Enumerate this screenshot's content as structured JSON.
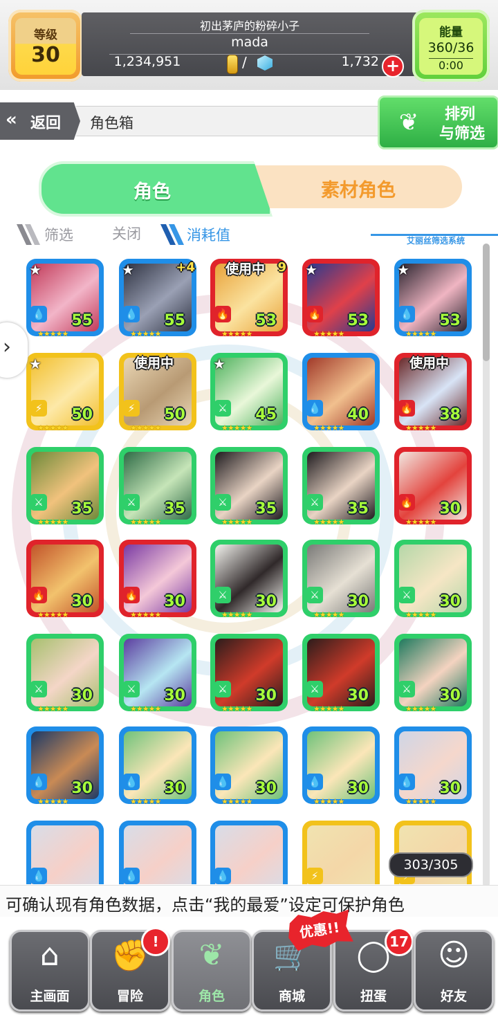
{
  "header": {
    "level_label": "等级",
    "level_value": "30",
    "player_title": "初出茅庐的粉碎小子",
    "player_name": "mada",
    "gold": "1,234,951",
    "slash": "/",
    "gems": "1,732",
    "add_label": "+",
    "energy_label": "能量",
    "energy_value": "360/36",
    "energy_timer": "0:00"
  },
  "nav": {
    "back_icon": "«",
    "back_label": "返回",
    "page_title": "角色箱",
    "sort_line1": "排列",
    "sort_line2": "与筛选",
    "sort_icon": "bunny-icon"
  },
  "tabs": {
    "characters": "角色",
    "materials": "素材角色"
  },
  "filter": {
    "filter_label": "筛选",
    "filter_state": "关闭",
    "sort_label": "消耗值",
    "system_label": "艾丽丝筛选系统"
  },
  "colors": {
    "water": "#1f8ee8",
    "fire": "#e0232b",
    "wood": "#2fcf6a",
    "thunder": "#f2c21b"
  },
  "cards": [
    {
      "level": "55",
      "element": "water",
      "star": true,
      "badge": "",
      "plus": ""
    },
    {
      "level": "55",
      "element": "water",
      "star": true,
      "badge": "",
      "plus": "+4"
    },
    {
      "level": "53",
      "element": "fire",
      "star": false,
      "badge": "使用中",
      "plus": "9"
    },
    {
      "level": "53",
      "element": "fire",
      "star": true,
      "badge": "",
      "plus": ""
    },
    {
      "level": "53",
      "element": "water",
      "star": true,
      "badge": "",
      "plus": ""
    },
    {
      "level": "50",
      "element": "thunder",
      "star": true,
      "badge": "",
      "plus": ""
    },
    {
      "level": "50",
      "element": "thunder",
      "star": false,
      "badge": "使用中",
      "plus": ""
    },
    {
      "level": "45",
      "element": "wood",
      "star": true,
      "badge": "",
      "plus": ""
    },
    {
      "level": "40",
      "element": "water",
      "star": false,
      "badge": "",
      "plus": ""
    },
    {
      "level": "38",
      "element": "fire",
      "star": false,
      "badge": "使用中",
      "plus": ""
    },
    {
      "level": "35",
      "element": "wood",
      "star": false,
      "badge": "",
      "plus": ""
    },
    {
      "level": "35",
      "element": "wood",
      "star": false,
      "badge": "",
      "plus": ""
    },
    {
      "level": "35",
      "element": "wood",
      "star": false,
      "badge": "",
      "plus": ""
    },
    {
      "level": "35",
      "element": "wood",
      "star": false,
      "badge": "",
      "plus": ""
    },
    {
      "level": "30",
      "element": "fire",
      "star": false,
      "badge": "",
      "plus": ""
    },
    {
      "level": "30",
      "element": "fire",
      "star": false,
      "badge": "",
      "plus": ""
    },
    {
      "level": "30",
      "element": "fire",
      "star": false,
      "badge": "",
      "plus": ""
    },
    {
      "level": "30",
      "element": "wood",
      "star": false,
      "badge": "",
      "plus": ""
    },
    {
      "level": "30",
      "element": "wood",
      "star": false,
      "badge": "",
      "plus": ""
    },
    {
      "level": "30",
      "element": "wood",
      "star": false,
      "badge": "",
      "plus": ""
    },
    {
      "level": "30",
      "element": "wood",
      "star": false,
      "badge": "",
      "plus": ""
    },
    {
      "level": "30",
      "element": "wood",
      "star": false,
      "badge": "",
      "plus": ""
    },
    {
      "level": "30",
      "element": "wood",
      "star": false,
      "badge": "",
      "plus": ""
    },
    {
      "level": "30",
      "element": "wood",
      "star": false,
      "badge": "",
      "plus": ""
    },
    {
      "level": "30",
      "element": "wood",
      "star": false,
      "badge": "",
      "plus": ""
    },
    {
      "level": "30",
      "element": "water",
      "star": false,
      "badge": "",
      "plus": ""
    },
    {
      "level": "30",
      "element": "water",
      "star": false,
      "badge": "",
      "plus": ""
    },
    {
      "level": "30",
      "element": "water",
      "star": false,
      "badge": "",
      "plus": ""
    },
    {
      "level": "30",
      "element": "water",
      "star": false,
      "badge": "",
      "plus": ""
    },
    {
      "level": "30",
      "element": "water",
      "star": false,
      "badge": "",
      "plus": ""
    },
    {
      "level": "",
      "element": "water",
      "star": false,
      "badge": "",
      "plus": ""
    },
    {
      "level": "",
      "element": "water",
      "star": false,
      "badge": "",
      "plus": ""
    },
    {
      "level": "",
      "element": "water",
      "star": false,
      "badge": "",
      "plus": ""
    },
    {
      "level": "",
      "element": "thunder",
      "star": false,
      "badge": "",
      "plus": ""
    },
    {
      "level": "",
      "element": "thunder",
      "star": false,
      "badge": "",
      "plus": ""
    }
  ],
  "card_rarity": "★★★★★",
  "card_count": "303/305",
  "ticker": "可确认现有角色数据，点击“我的最爱”设定可保护角色",
  "bottom_nav": [
    {
      "label": "主画面",
      "icon": "home-icon",
      "glyph": "⌂",
      "active": false,
      "notif": ""
    },
    {
      "label": "冒险",
      "icon": "fist-icon",
      "glyph": "✊",
      "active": false,
      "notif": "!"
    },
    {
      "label": "角色",
      "icon": "bunny-icon",
      "glyph": "❦",
      "active": true,
      "notif": ""
    },
    {
      "label": "商城",
      "icon": "cart-icon",
      "glyph": "🛒",
      "active": false,
      "notif": ""
    },
    {
      "label": "扭蛋",
      "icon": "egg-icon",
      "glyph": "◯",
      "active": false,
      "notif": "17"
    },
    {
      "label": "好友",
      "icon": "friends-icon",
      "glyph": "☺",
      "active": false,
      "notif": ""
    }
  ],
  "sale_tag": "优惠!!"
}
